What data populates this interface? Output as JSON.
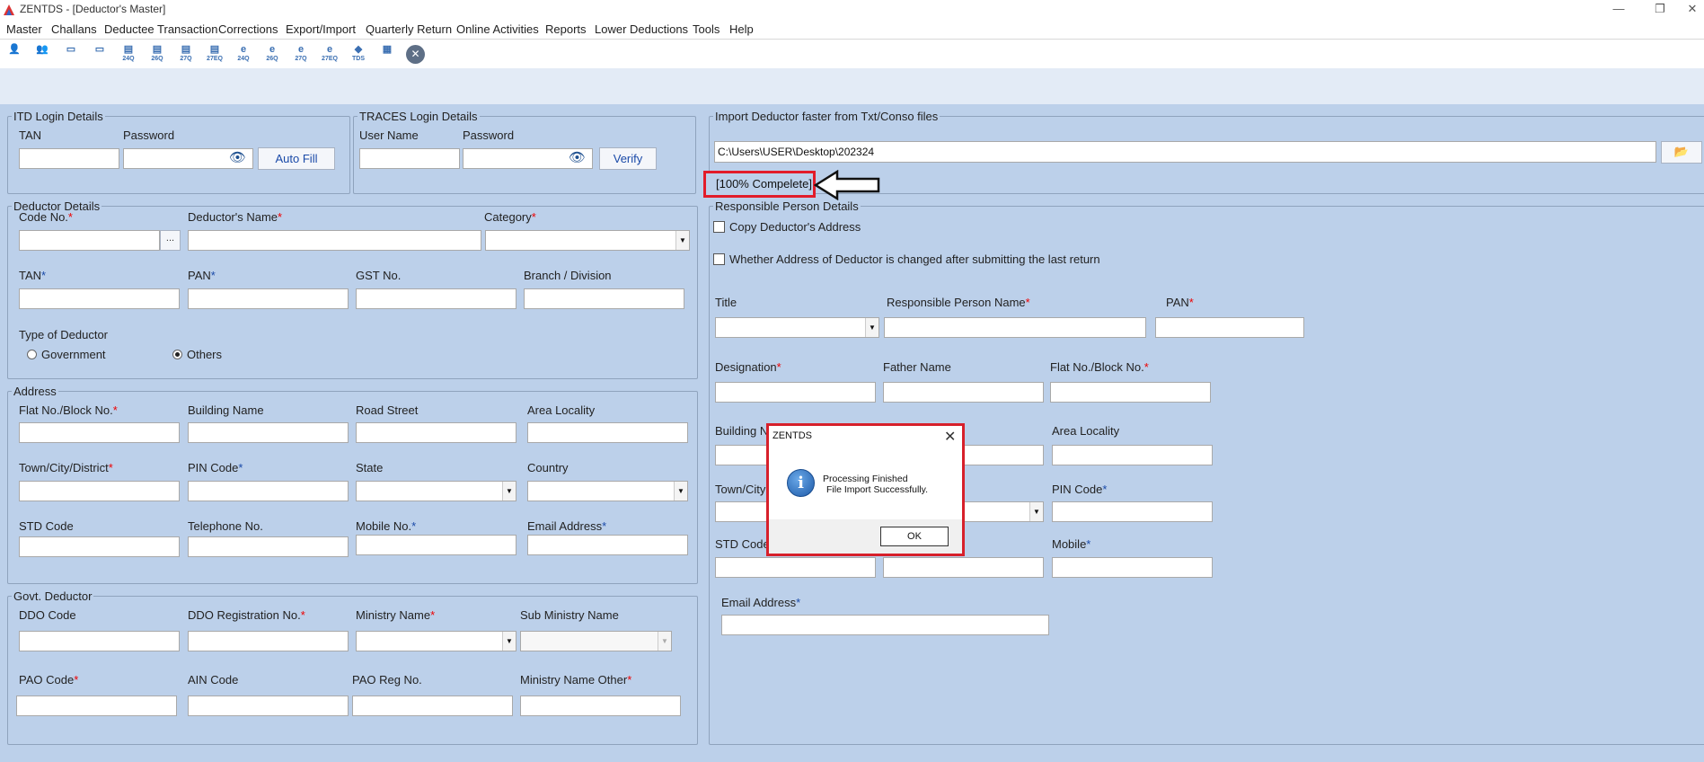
{
  "window": {
    "title": "ZENTDS - [Deductor's Master]",
    "minimize": "—",
    "restore": "❐",
    "close": "✕"
  },
  "menu": [
    "Master",
    "Challans",
    "Deductee Transaction",
    "Corrections",
    "Export/Import",
    "Quarterly Return",
    "Online Activities",
    "Reports",
    "Lower Deductions",
    "Tools",
    "Help"
  ],
  "toolbar": {
    "icons": [
      {
        "name": "deductor-icon",
        "glyph": "👤",
        "sub": ""
      },
      {
        "name": "deductees-icon",
        "glyph": "👥",
        "sub": ""
      },
      {
        "name": "user-form-icon",
        "glyph": "▭",
        "sub": ""
      },
      {
        "name": "user-form2-icon",
        "glyph": "▭",
        "sub": ""
      },
      {
        "name": "form-24q-icon",
        "glyph": "▤",
        "sub": "24Q"
      },
      {
        "name": "form-26q-icon",
        "glyph": "▤",
        "sub": "26Q"
      },
      {
        "name": "form-27q-icon",
        "glyph": "▤",
        "sub": "27Q"
      },
      {
        "name": "form-27eq-icon",
        "glyph": "▤",
        "sub": "27EQ"
      },
      {
        "name": "e24q-icon",
        "glyph": "e",
        "sub": "24Q"
      },
      {
        "name": "e26q-icon",
        "glyph": "e",
        "sub": "26Q"
      },
      {
        "name": "e27q-icon",
        "glyph": "e",
        "sub": "27Q"
      },
      {
        "name": "e27eq-icon",
        "glyph": "e",
        "sub": "27EQ"
      },
      {
        "name": "tds-icon",
        "glyph": "◆",
        "sub": "TDS"
      },
      {
        "name": "report-icon",
        "glyph": "▦",
        "sub": ""
      }
    ],
    "close_glyph": "✕"
  },
  "itd": {
    "legend": "ITD Login Details",
    "tan_label": "TAN",
    "password_label": "Password",
    "autofill": "Auto Fill",
    "eye": "👁"
  },
  "traces": {
    "legend": "TRACES Login Details",
    "user_label": "User Name",
    "password_label": "Password",
    "verify": "Verify",
    "eye": "👁"
  },
  "import": {
    "legend": "Import Deductor faster from Txt/Conso files",
    "path": "C:\\Users\\USER\\Desktop\\202324",
    "status": "[100% Compelete]",
    "browse_glyph": "📂"
  },
  "deductor": {
    "legend": "Deductor Details",
    "code": "Code No.",
    "name": "Deductor's Name",
    "category": "Category",
    "tan": "TAN",
    "pan": "PAN",
    "gst": "GST No.",
    "branch": "Branch / Division",
    "type": "Type of Deductor",
    "gov": "Government",
    "others": "Others",
    "selected_type": "Others",
    "ellipsis": "..."
  },
  "address": {
    "legend": "Address",
    "flat": "Flat No./Block No.",
    "building": "Building Name",
    "road": "Road Street",
    "area": "Area Locality",
    "town": "Town/City/District",
    "pin": "PIN Code",
    "state": "State",
    "country": "Country",
    "std": "STD Code",
    "tel": "Telephone No.",
    "mobile": "Mobile No.",
    "email": "Email Address"
  },
  "govt": {
    "legend": "Govt. Deductor",
    "ddo": "DDO Code",
    "ddo_reg": "DDO Registration No.",
    "ministry": "Ministry Name",
    "sub_ministry": "Sub Ministry Name",
    "pao": "PAO Code",
    "ain": "AIN Code",
    "pao_reg": "PAO Reg No.",
    "ministry_other": "Ministry Name Other"
  },
  "responsible": {
    "legend": "Responsible Person Details",
    "copy": "Copy Deductor's Address",
    "changed": "Whether Address of Deductor is changed after submitting the last return",
    "title": "Title",
    "name": "Responsible Person Name",
    "pan": "PAN",
    "designation": "Designation",
    "father": "Father Name",
    "flat": "Flat No./Block No.",
    "building": "Building N",
    "area": "Area Locality",
    "town": "Town/City",
    "pin": "PIN Code",
    "std": "STD Code",
    "mobile": "Mobile",
    "email": "Email Address"
  },
  "dialog": {
    "title": "ZENTDS",
    "close": "✕",
    "icon": "i",
    "line1": "Processing Finished",
    "line2": "File Import Successfully.",
    "ok": "OK"
  },
  "arrow": {
    "name": "pointer-arrow-icon"
  }
}
